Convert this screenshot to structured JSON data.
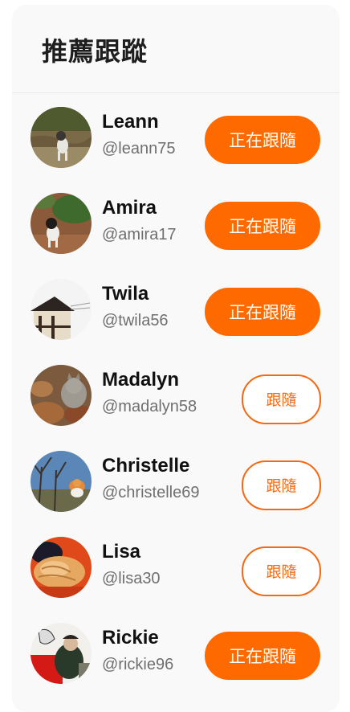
{
  "panel": {
    "title": "推薦跟蹤"
  },
  "colors": {
    "accent": "#ff6a00",
    "panel_bg": "#f9f9f9"
  },
  "users": [
    {
      "name": "Leann",
      "handle": "@leann75",
      "button_label": "正在跟隨",
      "following": true
    },
    {
      "name": "Amira",
      "handle": "@amira17",
      "button_label": "正在跟隨",
      "following": true
    },
    {
      "name": "Twila",
      "handle": "@twila56",
      "button_label": "正在跟隨",
      "following": true
    },
    {
      "name": "Madalyn",
      "handle": "@madalyn58",
      "button_label": "跟隨",
      "following": false
    },
    {
      "name": "Christelle",
      "handle": "@christelle69",
      "button_label": "跟隨",
      "following": false
    },
    {
      "name": "Lisa",
      "handle": "@lisa30",
      "button_label": "跟隨",
      "following": false
    },
    {
      "name": "Rickie",
      "handle": "@rickie96",
      "button_label": "正在跟隨",
      "following": true
    }
  ]
}
